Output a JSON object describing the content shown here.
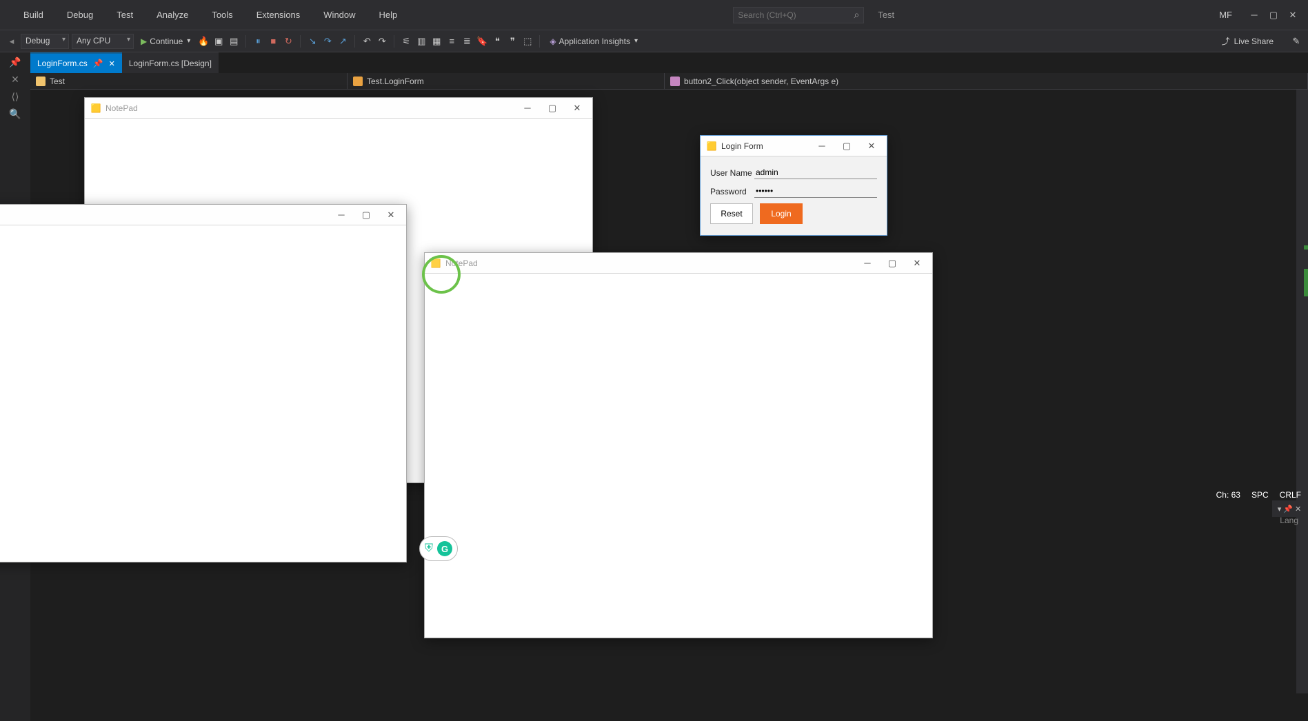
{
  "menu": {
    "build": "Build",
    "debug": "Debug",
    "test": "Test",
    "analyze": "Analyze",
    "tools": "Tools",
    "extensions": "Extensions",
    "window": "Window",
    "help": "Help"
  },
  "search": {
    "placeholder": "Search (Ctrl+Q)",
    "rightText": "Test"
  },
  "user": {
    "initials": "MF"
  },
  "toolbar": {
    "config": "Debug",
    "platform": "Any CPU",
    "continue": "Continue",
    "appinsights": "Application Insights",
    "liveshare": "Live Share"
  },
  "tabs": {
    "active": "LoginForm.cs",
    "inactive": "LoginForm.cs [Design]"
  },
  "navbar": {
    "project": "Test",
    "class": "Test.LoginForm",
    "member": "button2_Click(object sender, EventArgs e)"
  },
  "status": {
    "ch": "Ch: 63",
    "spc": "SPC",
    "crlf": "CRLF",
    "lang": "Lang"
  },
  "notepad1": {
    "title": "NotePad"
  },
  "notepad2": {
    "title": "NotePad"
  },
  "login": {
    "title": "Login Form",
    "userLabel": "User Name",
    "passLabel": "Password",
    "userValue": "admin",
    "passValue": "••••••",
    "reset": "Reset",
    "login": "Login"
  }
}
